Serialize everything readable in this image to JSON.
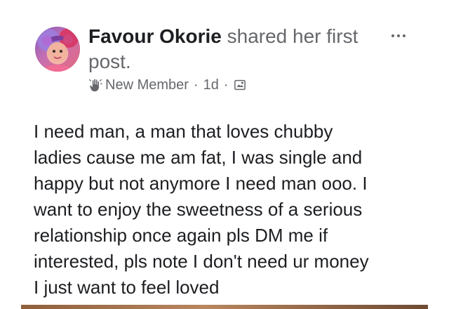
{
  "post": {
    "author_name": "Favour Okorie",
    "action_text": " shared her first post.",
    "badge_label": "New Member",
    "separator": "·",
    "time_ago": "1d",
    "body_text": "I need man, a man that loves chubby\nladies cause me am fat, I was single and\nhappy but not anymore I need man ooo. I\nwant to enjoy the sweetness of a serious\nrelationship once again pls DM me if\ninterested, pls note I don't need ur money\nI just want to feel loved",
    "icons": {
      "avatar": "profile-avatar",
      "more": "more-options-icon",
      "badge": "wave-icon",
      "privacy": "group-privacy-icon"
    }
  },
  "colors": {
    "text_primary": "#1c1e21",
    "text_secondary": "#65676b",
    "background": "#ffffff"
  }
}
